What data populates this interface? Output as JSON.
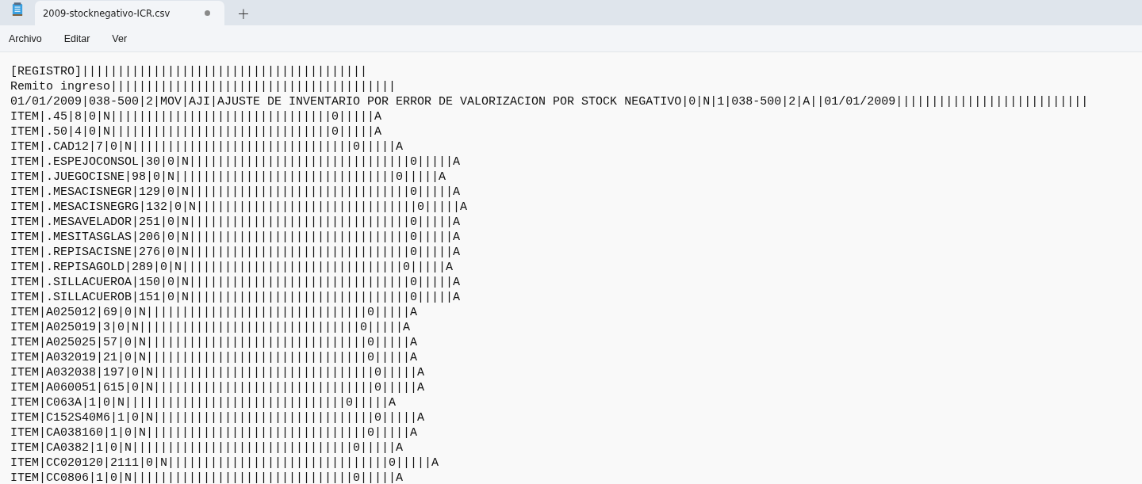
{
  "tab": {
    "title": "2009-stocknegativo-ICR.csv",
    "unsaved": true,
    "selected": true
  },
  "new_tab": "+",
  "menu": [
    "Archivo",
    "Editar",
    "Ver"
  ],
  "lines": [
    "[REGISTRO]||||||||||||||||||||||||||||||||||||||||",
    "Remito ingreso||||||||||||||||||||||||||||||||||||||||",
    "01/01/2009|038-500|2|MOV|AJI|AJUSTE DE INVENTARIO POR ERROR DE VALORIZACION POR STOCK NEGATIVO|0|N|1|038-500|2|A||01/01/2009|||||||||||||||||||||||||||",
    "ITEM|.45|8|0|N|||||||||||||||||||||||||||||||0|||||A",
    "ITEM|.50|4|0|N|||||||||||||||||||||||||||||||0|||||A",
    "ITEM|.CAD12|7|0|N|||||||||||||||||||||||||||||||0|||||A",
    "ITEM|.ESPEJOCONSOL|30|0|N|||||||||||||||||||||||||||||||0|||||A",
    "ITEM|.JUEGOCISNE|98|0|N|||||||||||||||||||||||||||||||0|||||A",
    "ITEM|.MESACISNEGR|129|0|N|||||||||||||||||||||||||||||||0|||||A",
    "ITEM|.MESACISNEGRG|132|0|N|||||||||||||||||||||||||||||||0|||||A",
    "ITEM|.MESAVELADOR|251|0|N|||||||||||||||||||||||||||||||0|||||A",
    "ITEM|.MESITASGLAS|206|0|N|||||||||||||||||||||||||||||||0|||||A",
    "ITEM|.REPISACISNE|276|0|N|||||||||||||||||||||||||||||||0|||||A",
    "ITEM|.REPISAGOLD|289|0|N|||||||||||||||||||||||||||||||0|||||A",
    "ITEM|.SILLACUEROA|150|0|N|||||||||||||||||||||||||||||||0|||||A",
    "ITEM|.SILLACUEROB|151|0|N|||||||||||||||||||||||||||||||0|||||A",
    "ITEM|A025012|69|0|N|||||||||||||||||||||||||||||||0|||||A",
    "ITEM|A025019|3|0|N|||||||||||||||||||||||||||||||0|||||A",
    "ITEM|A025025|57|0|N|||||||||||||||||||||||||||||||0|||||A",
    "ITEM|A032019|21|0|N|||||||||||||||||||||||||||||||0|||||A",
    "ITEM|A032038|197|0|N|||||||||||||||||||||||||||||||0|||||A",
    "ITEM|A060051|615|0|N|||||||||||||||||||||||||||||||0|||||A",
    "ITEM|C063A|1|0|N|||||||||||||||||||||||||||||||0|||||A",
    "ITEM|C152S40M6|1|0|N|||||||||||||||||||||||||||||||0|||||A",
    "ITEM|CA038160|1|0|N|||||||||||||||||||||||||||||||0|||||A",
    "ITEM|CA0382|1|0|N|||||||||||||||||||||||||||||||0|||||A",
    "ITEM|CC020120|2111|0|N|||||||||||||||||||||||||||||||0|||||A",
    "ITEM|CC0806|1|0|N|||||||||||||||||||||||||||||||0|||||A"
  ]
}
